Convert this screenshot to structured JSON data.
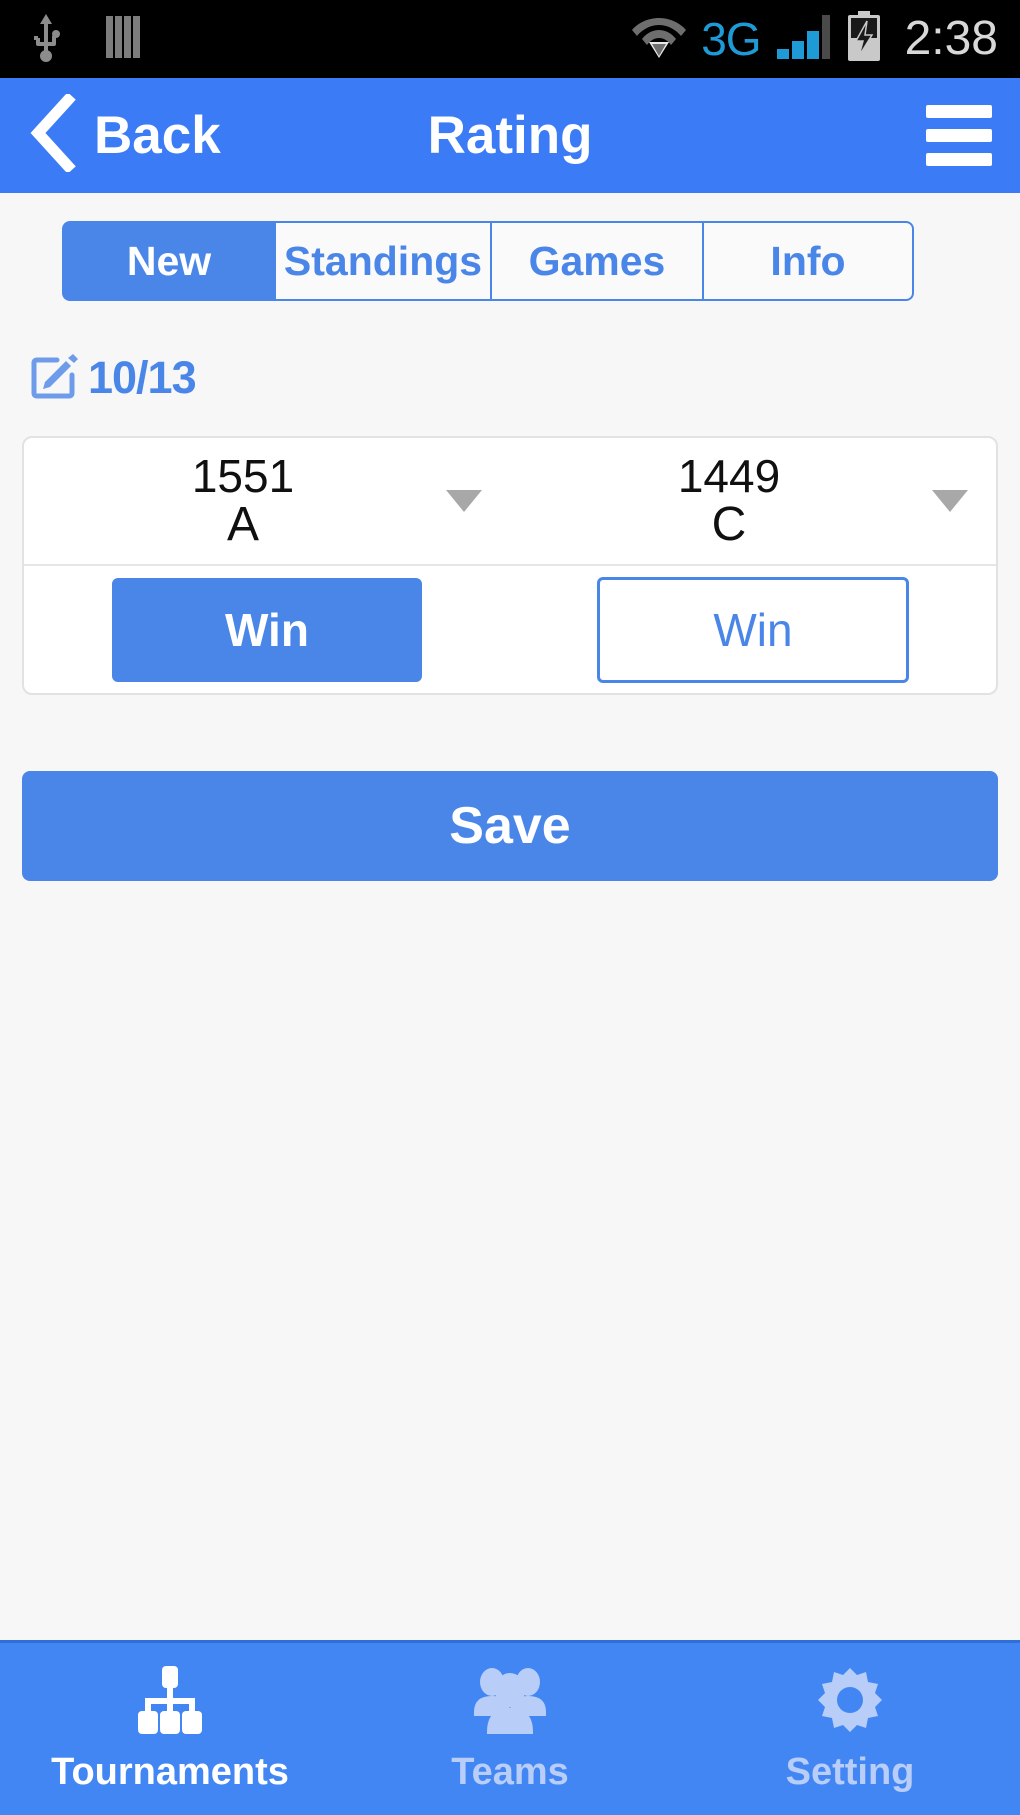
{
  "statusbar": {
    "usb_icon": "usb-icon",
    "vibrate_icon": "sim-card-icon",
    "wifi_icon": "wifi-icon",
    "network_label": "3G",
    "signal_icon": "cellular-signal-icon",
    "battery_icon": "battery-charging-icon",
    "clock": "2:38"
  },
  "header": {
    "back_icon": "chevron-left-icon",
    "back_label": "Back",
    "title": "Rating",
    "menu_icon": "hamburger-menu-icon"
  },
  "tabs": [
    {
      "label": "New",
      "active": true
    },
    {
      "label": "Standings",
      "active": false
    },
    {
      "label": "Games",
      "active": false
    },
    {
      "label": "Info",
      "active": false
    }
  ],
  "date_row": {
    "icon": "edit-square-icon",
    "label": "10/13"
  },
  "match": {
    "players": [
      {
        "rating": "1551",
        "name": "A",
        "caret_icon": "chevron-down-icon"
      },
      {
        "rating": "1449",
        "name": "C",
        "caret_icon": "chevron-down-icon"
      }
    ],
    "win_left": {
      "label": "Win",
      "selected": true
    },
    "win_right": {
      "label": "Win",
      "selected": false
    }
  },
  "save": {
    "label": "Save"
  },
  "bottomnav": [
    {
      "label": "Tournaments",
      "icon": "sitemap-icon",
      "active": true
    },
    {
      "label": "Teams",
      "icon": "users-icon",
      "active": false
    },
    {
      "label": "Setting",
      "icon": "gear-icon",
      "active": false
    }
  ],
  "colors": {
    "brand_blue": "#4a86e8",
    "header_blue": "#3b7bf6",
    "nav_blue": "#4286f4",
    "network_blue": "#1e9bd7",
    "page_bg": "#f7f7f7"
  }
}
